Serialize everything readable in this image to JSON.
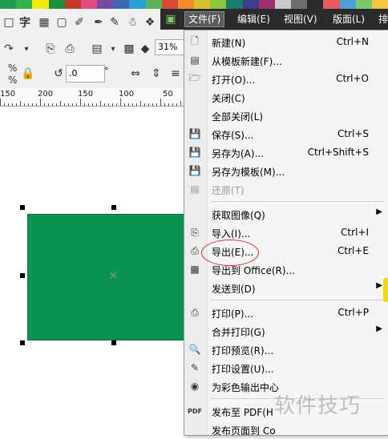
{
  "palette": [
    "#1e9c4e",
    "#2fb24a",
    "#f2ea0a",
    "#1d8f3c",
    "#c63a2c",
    "#e24a7b",
    "#7a4aa3",
    "#3e67b1",
    "#2c9fd8",
    "#5fb25c",
    "#d44b2f",
    "#f08c2a",
    "#d8c12f",
    "#8cc63e",
    "#1b7e6a",
    "#3d3d8f",
    "#9c2f6c",
    "#c9c9c9",
    "#6e6e6e",
    "#2a2a2a",
    "#e65c5c",
    "#4aa0d8",
    "#7bc96a",
    "#f4c542"
  ],
  "menubar": {
    "items": [
      {
        "label": "文件(F)"
      },
      {
        "label": "编辑(E)"
      },
      {
        "label": "视图(V)"
      },
      {
        "label": "版面(L)"
      },
      {
        "label": "排"
      }
    ]
  },
  "toolbar": {
    "text_tool": "字",
    "zoom": "31%",
    "rotate_value": ".0",
    "degree_symbol": "°",
    "pct1": "%",
    "pct2": "%"
  },
  "ruler": {
    "labels": [
      "150",
      "200",
      "150",
      "100",
      "50"
    ]
  },
  "file_menu": {
    "items": [
      {
        "label": "新建(N)",
        "shortcut": "Ctrl+N",
        "icon": "new-doc-icon"
      },
      {
        "label": "从模板新建(F)...",
        "shortcut": "",
        "icon": "template-icon"
      },
      {
        "label": "打开(O)...",
        "shortcut": "Ctrl+O",
        "icon": "folder-icon"
      },
      {
        "label": "关闭(C)",
        "shortcut": "",
        "icon": "close-doc-icon"
      },
      {
        "label": "全部关闭(L)",
        "shortcut": "",
        "icon": "close-all-icon"
      },
      {
        "label": "保存(S)...",
        "shortcut": "Ctrl+S",
        "icon": "save-icon"
      },
      {
        "label": "另存为(A)...",
        "shortcut": "Ctrl+Shift+S",
        "icon": "save-as-icon"
      },
      {
        "label": "另存为模板(M)...",
        "shortcut": "",
        "icon": "save-template-icon"
      },
      {
        "label": "还原(T)",
        "shortcut": "",
        "icon": "revert-icon",
        "disabled": true
      },
      {
        "label": "获取图像(Q)",
        "shortcut": "",
        "submenu": true
      },
      {
        "label": "导入(I)...",
        "shortcut": "Ctrl+I",
        "icon": "import-icon"
      },
      {
        "label": "导出(E)...",
        "shortcut": "Ctrl+E",
        "icon": "export-icon"
      },
      {
        "label": "导出到 Office(R)...",
        "shortcut": "",
        "icon": "export-office-icon"
      },
      {
        "label": "发送到(D)",
        "shortcut": "",
        "submenu": true
      },
      {
        "label": "打印(P)...",
        "shortcut": "Ctrl+P",
        "icon": "print-icon"
      },
      {
        "label": "合并打印(G)",
        "shortcut": "",
        "submenu": true
      },
      {
        "label": "打印预览(R)...",
        "shortcut": "",
        "icon": "print-preview-icon"
      },
      {
        "label": "打印设置(U)...",
        "shortcut": "",
        "icon": "print-setup-icon"
      },
      {
        "label": "为彩色输出中心",
        "shortcut": "",
        "icon": "color-output-icon"
      },
      {
        "label": "发布至 PDF(H",
        "shortcut": "",
        "icon": "pdf-icon"
      },
      {
        "label": "发布页面到 Co",
        "shortcut": "",
        "icon": "publish-icon"
      }
    ]
  },
  "watermark": "软件技巧",
  "colors": {
    "rect_fill": "#0b9150",
    "menubar_bg": "#2b2b2b",
    "highlight": "#d9302c"
  }
}
